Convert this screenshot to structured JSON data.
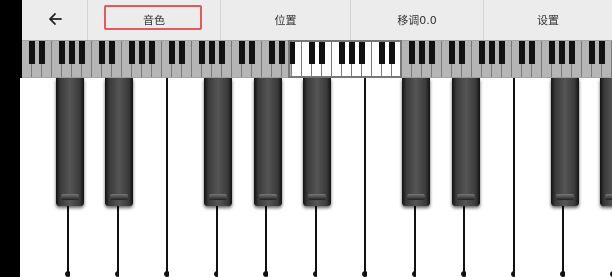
{
  "toolbar": {
    "back_icon": "arrow-left-icon",
    "sound_label": "音色",
    "position_label": "位置",
    "transpose_label": "移调0.0",
    "settings_label": "设置",
    "highlight_color": "#e45a5a"
  },
  "mini_keyboard": {
    "viewport_outline": true
  }
}
